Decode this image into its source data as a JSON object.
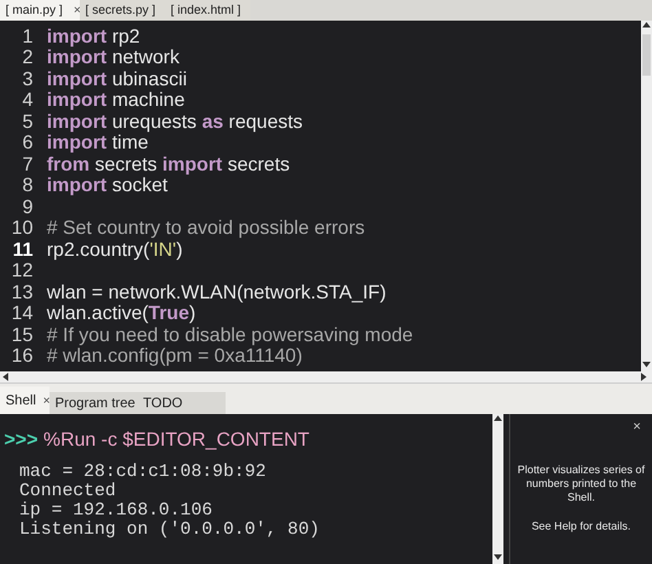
{
  "editor_tabs": [
    {
      "label": "[ main.py ]",
      "selected": true,
      "close": "×"
    },
    {
      "label": "[ secrets.py ]",
      "selected": false
    },
    {
      "label": "[ index.html ]",
      "selected": false
    }
  ],
  "code_lines": [
    {
      "number": "1",
      "current": false,
      "tokens": [
        {
          "kind": "keyword",
          "text": "import"
        },
        {
          "kind": "plain",
          "text": " rp2"
        }
      ]
    },
    {
      "number": "2",
      "current": false,
      "tokens": [
        {
          "kind": "keyword",
          "text": "import"
        },
        {
          "kind": "plain",
          "text": " network"
        }
      ]
    },
    {
      "number": "3",
      "current": false,
      "tokens": [
        {
          "kind": "keyword",
          "text": "import"
        },
        {
          "kind": "plain",
          "text": " ubinascii"
        }
      ]
    },
    {
      "number": "4",
      "current": false,
      "tokens": [
        {
          "kind": "keyword",
          "text": "import"
        },
        {
          "kind": "plain",
          "text": " machine"
        }
      ]
    },
    {
      "number": "5",
      "current": false,
      "tokens": [
        {
          "kind": "keyword",
          "text": "import"
        },
        {
          "kind": "plain",
          "text": " urequests "
        },
        {
          "kind": "keyword",
          "text": "as"
        },
        {
          "kind": "plain",
          "text": " requests"
        }
      ]
    },
    {
      "number": "6",
      "current": false,
      "tokens": [
        {
          "kind": "keyword",
          "text": "import"
        },
        {
          "kind": "plain",
          "text": " time"
        }
      ]
    },
    {
      "number": "7",
      "current": false,
      "tokens": [
        {
          "kind": "keyword",
          "text": "from"
        },
        {
          "kind": "plain",
          "text": " secrets "
        },
        {
          "kind": "keyword",
          "text": "import"
        },
        {
          "kind": "plain",
          "text": " secrets"
        }
      ]
    },
    {
      "number": "8",
      "current": false,
      "tokens": [
        {
          "kind": "keyword",
          "text": "import"
        },
        {
          "kind": "plain",
          "text": " socket"
        }
      ]
    },
    {
      "number": "9",
      "current": false
    },
    {
      "number": "10",
      "current": false,
      "tokens": [
        {
          "kind": "comment",
          "text": "# Set country to avoid possible errors"
        }
      ]
    },
    {
      "number": "11",
      "current": true,
      "tokens": [
        {
          "kind": "plain",
          "text": "rp2.country("
        },
        {
          "kind": "string",
          "text": "'IN'"
        },
        {
          "kind": "plain",
          "text": ")"
        }
      ]
    },
    {
      "number": "12",
      "current": false
    },
    {
      "number": "13",
      "current": false,
      "tokens": [
        {
          "kind": "plain",
          "text": "wlan = network.WLAN(network.STA_IF)"
        }
      ]
    },
    {
      "number": "14",
      "current": false,
      "tokens": [
        {
          "kind": "plain",
          "text": "wlan.active("
        },
        {
          "kind": "keyword",
          "text": "True"
        },
        {
          "kind": "plain",
          "text": ")"
        }
      ]
    },
    {
      "number": "15",
      "current": false,
      "tokens": [
        {
          "kind": "comment",
          "text": "# If you need to disable powersaving mode"
        }
      ]
    },
    {
      "number": "16",
      "current": false,
      "tokens": [
        {
          "kind": "comment",
          "text": "# wlan.config(pm = 0xa11140)"
        }
      ]
    }
  ],
  "panel_tabs": [
    {
      "label": "Shell",
      "selected": true,
      "close": "×"
    },
    {
      "label": "Program tree",
      "selected": false
    },
    {
      "label": "TODO",
      "selected": false
    }
  ],
  "shell": {
    "prompt": ">>>",
    "command": "%Run -c $EDITOR_CONTENT",
    "output": [
      "mac = 28:cd:c1:08:9b:92",
      "Connected",
      "ip = 192.168.0.106",
      "Listening on ('0.0.0.0', 80)"
    ]
  },
  "plotter": {
    "close": "×",
    "message": "Plotter visualizes series of numbers printed to the Shell.",
    "help": "See Help for details."
  }
}
